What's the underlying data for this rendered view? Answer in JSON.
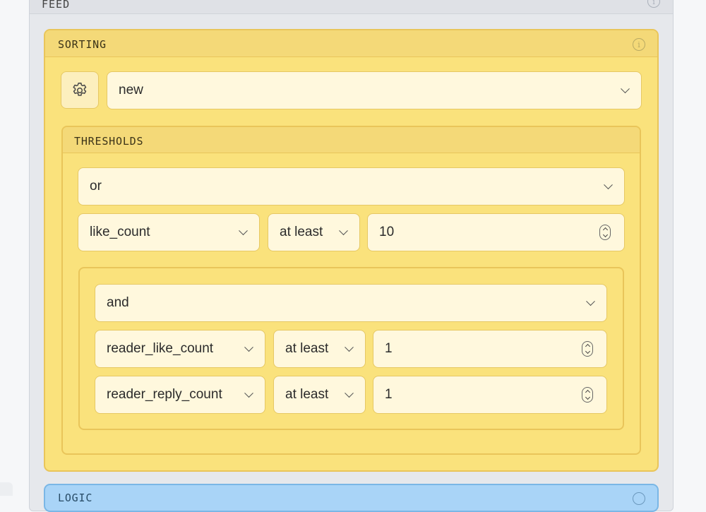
{
  "feed": {
    "title": "FEED"
  },
  "sorting": {
    "title": "SORTING",
    "sort_value": "new",
    "thresholds": {
      "title": "THRESHOLDS",
      "combinator": "or",
      "rule": {
        "field": "like_count",
        "operator": "at least",
        "value": "10"
      },
      "group": {
        "combinator": "and",
        "rules": [
          {
            "field": "reader_like_count",
            "operator": "at least",
            "value": "1"
          },
          {
            "field": "reader_reply_count",
            "operator": "at least",
            "value": "1"
          }
        ]
      }
    }
  },
  "logic": {
    "title": "LOGIC"
  },
  "icons": {
    "info": "info-icon",
    "settings": "gear-icon",
    "dropdown": "chevron-down-icon",
    "number": "stepper-icon"
  },
  "colors": {
    "sorting_bg": "#fae27c",
    "sorting_border": "#e9c55a",
    "input_bg": "#fff8dd",
    "logic_bg": "#a9d4f7"
  }
}
